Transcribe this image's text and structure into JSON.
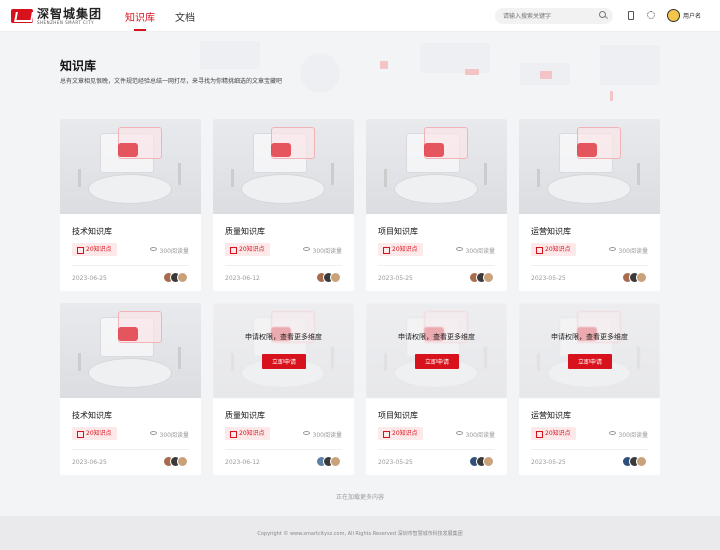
{
  "nav": {
    "logo_cn": "深智城集团",
    "logo_en": "SHENZHEN SMART CITY",
    "tabs": [
      {
        "label": "知识库",
        "active": true
      },
      {
        "label": "文档",
        "active": false
      }
    ],
    "search_placeholder": "请输入搜索关键字",
    "username": "用户名"
  },
  "header": {
    "title": "知识库",
    "subtitle": "总有文章相见恨晚，文件规范经验总结一网打尽，来寻找为你精挑细选的文章宝藏吧"
  },
  "cards": [
    {
      "title": "技术知识库",
      "tag": "20知识点",
      "reads": "300阅读量",
      "date": "2023-06-25",
      "locked": false
    },
    {
      "title": "质量知识库",
      "tag": "20知识点",
      "reads": "300阅读量",
      "date": "2023-06-12",
      "locked": false
    },
    {
      "title": "项目知识库",
      "tag": "20知识点",
      "reads": "300阅读量",
      "date": "2023-05-25",
      "locked": false
    },
    {
      "title": "运营知识库",
      "tag": "20知识点",
      "reads": "300阅读量",
      "date": "2023-05-25",
      "locked": false
    },
    {
      "title": "技术知识库",
      "tag": "20知识点",
      "reads": "300阅读量",
      "date": "2023-06-25",
      "locked": false
    },
    {
      "title": "质量知识库",
      "tag": "20知识点",
      "reads": "300阅读量",
      "date": "2023-06-12",
      "locked": true
    },
    {
      "title": "项目知识库",
      "tag": "20知识点",
      "reads": "300阅读量",
      "date": "2023-05-25",
      "locked": true
    },
    {
      "title": "运营知识库",
      "tag": "20知识点",
      "reads": "300阅读量",
      "date": "2023-05-25",
      "locked": true
    }
  ],
  "lock": {
    "text": "申请权限，查看更多维度",
    "button": "立即申请"
  },
  "loading_text": "正在加载更多内容",
  "footer": {
    "copyright": "Copyright © www.smartcitysz.com, All Rights Reserved    深圳市智慧城市科技发展集团"
  },
  "colors": {
    "accent": "#d7121c",
    "tag_bg": "#fde9ea"
  },
  "icons": [
    "search-icon",
    "phone-icon",
    "gear-icon",
    "eye-icon",
    "book-icon"
  ]
}
